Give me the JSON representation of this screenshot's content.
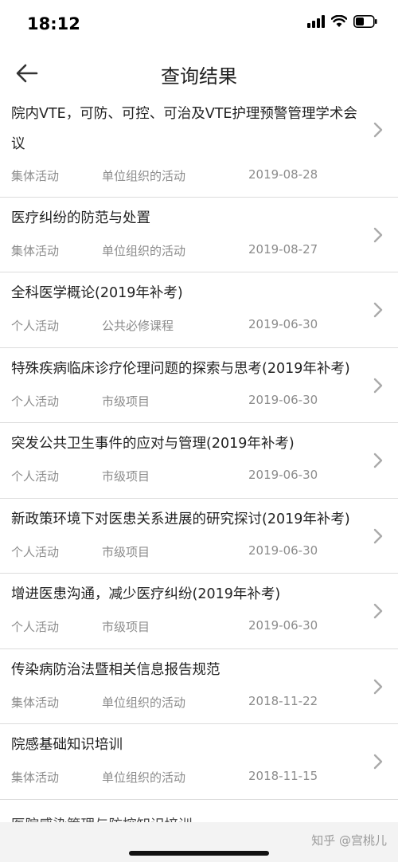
{
  "status": {
    "time": "18:12"
  },
  "nav": {
    "title": "查询结果",
    "back_icon": "arrow-left-icon"
  },
  "items": [
    {
      "title": "院内VTE，可防、可控、可治及VTE护理预警管理学术会议",
      "type": "集体活动",
      "org": "单位组织的活动",
      "date": "2019-08-28"
    },
    {
      "title": "医疗纠纷的防范与处置",
      "type": "集体活动",
      "org": "单位组织的活动",
      "date": "2019-08-27"
    },
    {
      "title": "全科医学概论(2019年补考)",
      "type": "个人活动",
      "org": "公共必修课程",
      "date": "2019-06-30"
    },
    {
      "title": "特殊疾病临床诊疗伦理问题的探索与思考(2019年补考)",
      "type": "个人活动",
      "org": "市级项目",
      "date": "2019-06-30"
    },
    {
      "title": "突发公共卫生事件的应对与管理(2019年补考)",
      "type": "个人活动",
      "org": "市级项目",
      "date": "2019-06-30"
    },
    {
      "title": "新政策环境下对医患关系进展的研究探讨(2019年补考)",
      "type": "个人活动",
      "org": "市级项目",
      "date": "2019-06-30"
    },
    {
      "title": "增进医患沟通，减少医疗纠纷(2019年补考)",
      "type": "个人活动",
      "org": "市级项目",
      "date": "2019-06-30"
    },
    {
      "title": "传染病防治法暨相关信息报告规范",
      "type": "集体活动",
      "org": "单位组织的活动",
      "date": "2018-11-22"
    },
    {
      "title": "院感基础知识培训",
      "type": "集体活动",
      "org": "单位组织的活动",
      "date": "2018-11-15"
    }
  ],
  "partial_item": {
    "title": "医院感染管理与防控知识培训"
  },
  "watermark": "知乎 @宫桃儿"
}
